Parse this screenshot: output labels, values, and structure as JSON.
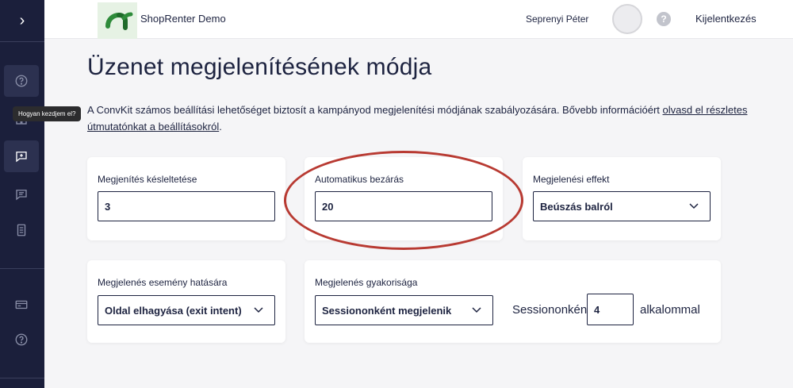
{
  "header": {
    "shop_name": "ShopRenter Demo",
    "user_name": "Seprenyi Péter",
    "help_symbol": "?",
    "logout_label": "Kijelentkezés"
  },
  "sidebar": {
    "toggle_symbol": "›",
    "tooltip": "Hogyan kezdjem el?",
    "items": [
      {
        "icon": "question-circle-icon"
      },
      {
        "icon": "dashboard-grid-icon"
      },
      {
        "icon": "message-plus-icon",
        "active": true
      },
      {
        "icon": "chat-lines-icon"
      },
      {
        "icon": "document-icon"
      },
      {
        "icon": "card-icon"
      },
      {
        "icon": "question-circle-icon"
      }
    ]
  },
  "main": {
    "title": "Üzenet megjelenítésének módja",
    "intro_text": "A ConvKit számos beállítási lehetőséget biztosít a kampányod megjelenítési módjának szabályozására. Bővebb információért ",
    "intro_link": "olvasd el részletes útmutatónkat a beállításokról",
    "intro_end": ".",
    "cards": {
      "delay": {
        "label": "Megjenítés késleltetése",
        "value": "3"
      },
      "auto_close": {
        "label": "Automatikus bezárás",
        "value": "20"
      },
      "effect": {
        "label": "Megjelenési effekt",
        "value": "Beúszás balról"
      },
      "trigger": {
        "label": "Megjelenés esemény hatására",
        "value": "Oldal elhagyása (exit intent)"
      },
      "frequency": {
        "label": "Megjelenés gyakorisága",
        "value": "Sessiononként megjelenik",
        "prefix": "Sessiononként",
        "count": "4",
        "suffix": "alkalommal"
      }
    }
  },
  "colors": {
    "sidebar_bg": "#1b1f3b",
    "text": "#1d2340",
    "annotation": "#b83a32",
    "logo_green": "#2e8b3a"
  }
}
